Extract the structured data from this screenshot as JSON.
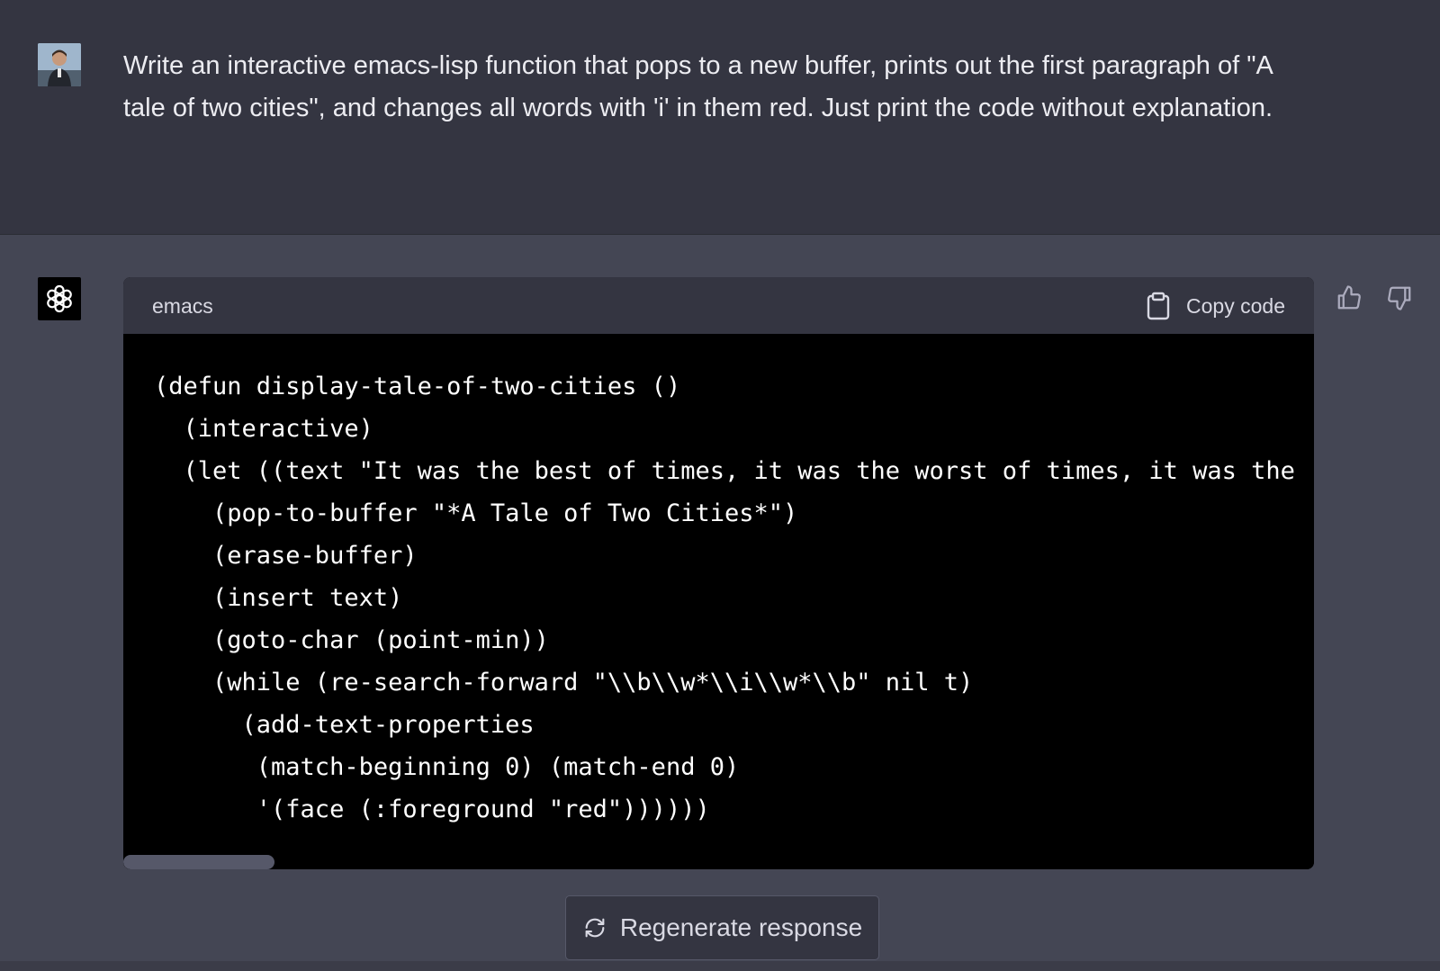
{
  "user_message": {
    "text": "Write an interactive emacs-lisp function that pops to a new buffer, prints out the first paragraph of \"A tale of two cities\", and changes all words with 'i' in them red. Just print the code without explanation."
  },
  "assistant_message": {
    "code_block": {
      "language": "emacs",
      "copy_label": "Copy code",
      "lines": [
        "(defun display-tale-of-two-cities ()",
        "  (interactive)",
        "  (let ((text \"It was the best of times, it was the worst of times, it was the",
        "    (pop-to-buffer \"*A Tale of Two Cities*\")",
        "    (erase-buffer)",
        "    (insert text)",
        "    (goto-char (point-min))",
        "    (while (re-search-forward \"\\\\b\\\\w*\\\\i\\\\w*\\\\b\" nil t)",
        "      (add-text-properties",
        "       (match-beginning 0) (match-end 0)",
        "       '(face (:foreground \"red\"))))))"
      ]
    },
    "feedback": {
      "thumbs_up_icon": "thumbs-up-icon",
      "thumbs_down_icon": "thumbs-down-icon"
    }
  },
  "regenerate": {
    "label": "Regenerate response"
  },
  "colors": {
    "user_bg": "#343541",
    "assistant_bg": "#444654",
    "code_bg": "#000000",
    "code_header_bg": "#343541"
  }
}
